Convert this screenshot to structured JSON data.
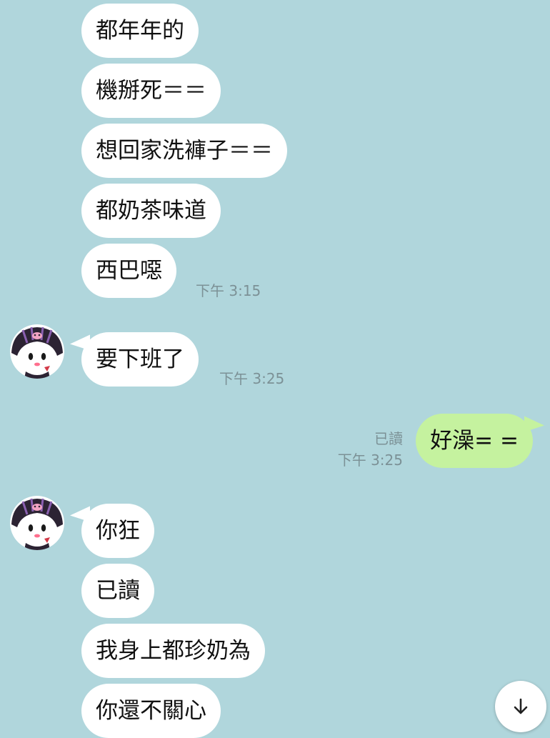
{
  "messages": [
    {
      "text": "都年年的"
    },
    {
      "text": "機掰死＝＝"
    },
    {
      "text": "想回家洗褲子＝＝"
    },
    {
      "text": "都奶茶味道"
    },
    {
      "text": "西巴噁",
      "time": "下午 3:15"
    },
    {
      "text": "要下班了",
      "time": "下午 3:25"
    },
    {
      "text": "好澡= =",
      "read": "已讀",
      "time": "下午 3:25"
    },
    {
      "text": "你狂"
    },
    {
      "text": "已讀"
    },
    {
      "text": "我身上都珍奶為"
    },
    {
      "text": "你還不關心"
    }
  ],
  "icons": {
    "avatar": "kuromi-avatar",
    "scroll_down": "arrow-down-icon"
  },
  "colors": {
    "background": "#b0d6dc",
    "incoming_bubble": "#ffffff",
    "outgoing_bubble": "#c5f29f",
    "meta_text": "#7c9196"
  }
}
